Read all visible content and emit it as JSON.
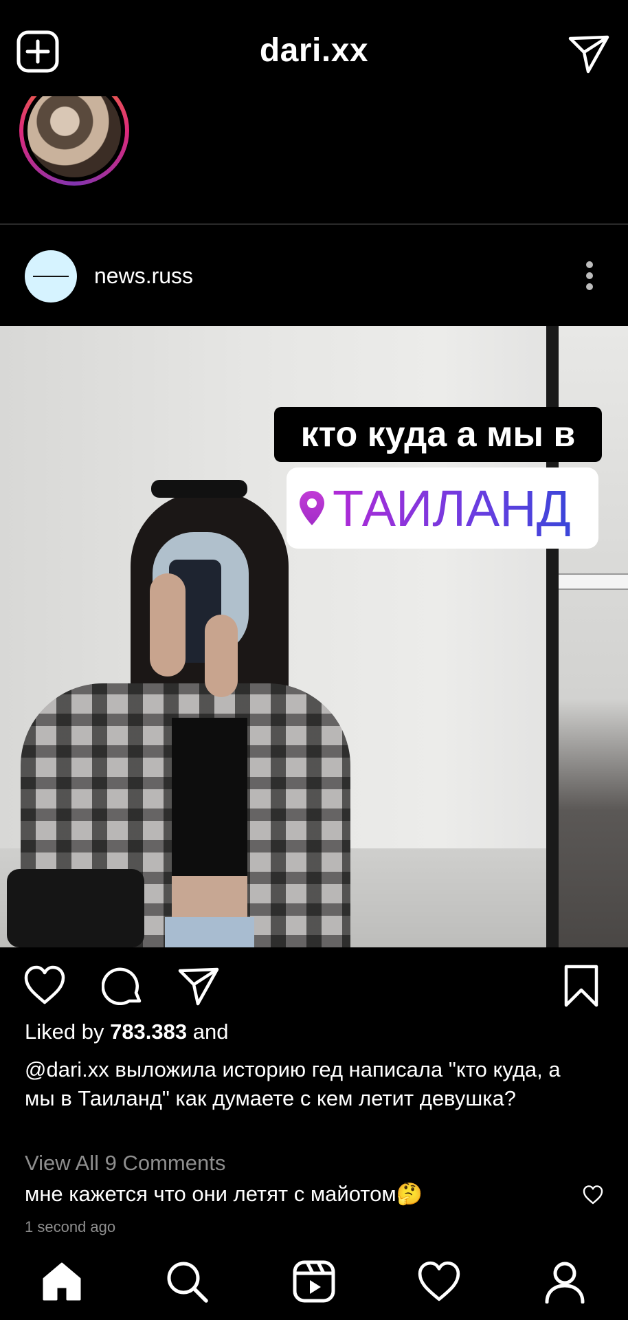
{
  "header": {
    "title": "dari.xx"
  },
  "post": {
    "username": "news.russ",
    "stickers": {
      "line1": "кто куда а мы в",
      "location": "ТАИЛАНД"
    },
    "likes_prefix": "Liked by ",
    "likes_count": "783.383",
    "likes_suffix": " and",
    "caption": "@dari.xx выложила историю гед написала \"кто куда, а мы в Таиланд\" как думаете с кем летит девушка?",
    "view_comments": "View All 9 Comments",
    "comment": "мне кажется что они летят с майотом🤔",
    "timestamp": "1 second ago"
  },
  "icons": {
    "top_left": "new-post-icon",
    "top_right": "direct-message-icon",
    "post_menu": "more-vertical-icon",
    "actions": [
      "heart-icon",
      "comment-icon",
      "share-icon",
      "bookmark-icon"
    ],
    "nav": [
      "home-icon",
      "search-icon",
      "reels-icon",
      "heart-icon",
      "profile-icon"
    ]
  },
  "colors": {
    "background": "#000000",
    "muted_text": "#8e8e8e",
    "location_gradient_start": "#b02ad6",
    "location_gradient_end": "#3b46d9"
  }
}
